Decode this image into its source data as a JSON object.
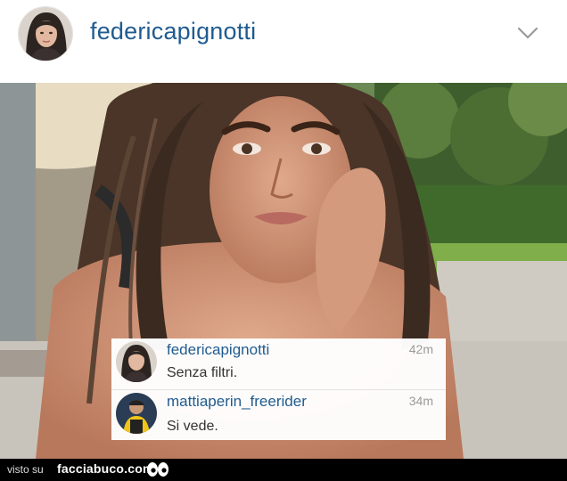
{
  "header": {
    "username": "federicapignotti",
    "avatar_icon": "profile-avatar",
    "menu_icon": "chevron-down-icon"
  },
  "photo": {
    "description_icon": "post-photo"
  },
  "comments": [
    {
      "username": "federicapignotti",
      "text": "Senza filtri.",
      "time": "42m"
    },
    {
      "username": "mattiaperin_freerider",
      "text": "Si vede.",
      "time": "34m"
    }
  ],
  "footer": {
    "visto_label": "visto su",
    "brand": "facciabuco.com",
    "logo_icon": "eyes-logo-icon"
  },
  "colors": {
    "username_blue": "#1f5b8f",
    "time_gray": "#9a9a9a",
    "footer_bg": "#000000"
  }
}
